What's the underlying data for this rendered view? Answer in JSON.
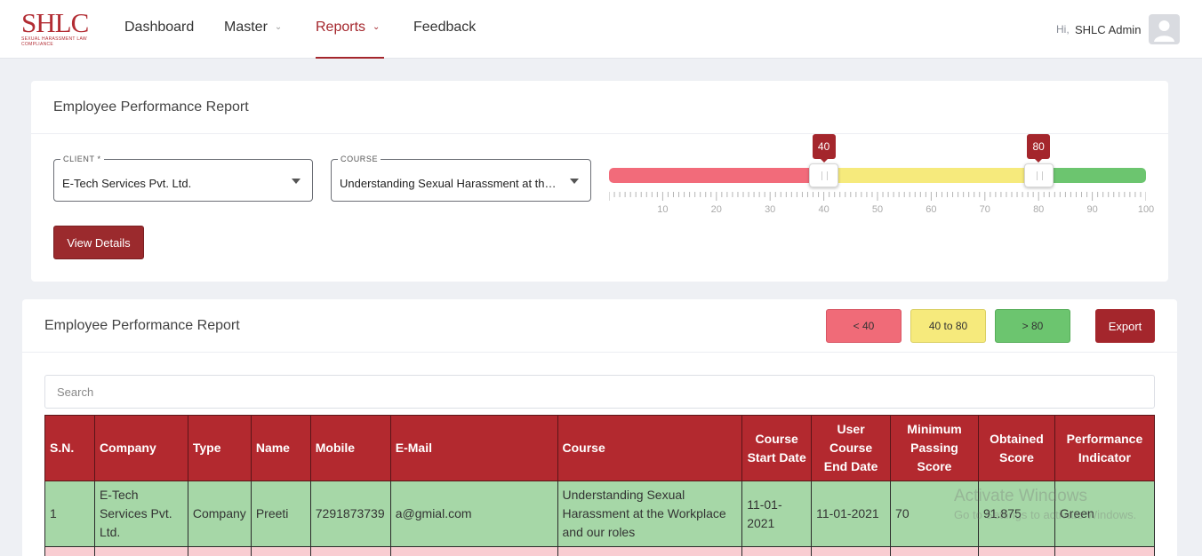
{
  "header": {
    "logo_main": "SHLC",
    "logo_sub": "Sexual Harassment Law Compliance",
    "nav": [
      {
        "label": "Dashboard"
      },
      {
        "label": "Master"
      },
      {
        "label": "Reports"
      },
      {
        "label": "Feedback"
      }
    ],
    "greeting": "Hi,",
    "user_name": "SHLC Admin"
  },
  "filters": {
    "title": "Employee Performance Report",
    "client_label": "CLIENT *",
    "client_value": "E-Tech Services Pvt. Ltd.",
    "course_label": "COURSE",
    "course_value": "Understanding Sexual Harassment at the Workplace and our roles",
    "view_button": "View Details",
    "range_low": "40",
    "range_high": "80",
    "range_min": 0,
    "range_max": 100,
    "scale_labels": [
      "10",
      "20",
      "30",
      "40",
      "50",
      "60",
      "70",
      "80",
      "90",
      "100"
    ]
  },
  "report": {
    "title": "Employee Performance Report",
    "buttons": {
      "low": "< 40",
      "mid": "40 to 80",
      "high": "> 80",
      "export": "Export"
    },
    "search_placeholder": "Search",
    "columns": [
      "S.N.",
      "Company",
      "Type",
      "Name",
      "Mobile",
      "E-Mail",
      "Course",
      "Course Start Date",
      "User Course End Date",
      "Minimum Passing Score",
      "Obtained Score",
      "Performance Indicator"
    ],
    "rows": [
      {
        "sn": "1",
        "company": "E-Tech Services Pvt. Ltd.",
        "type": "Company",
        "name": "Preeti",
        "mobile": "7291873739",
        "email": "a@gmial.com",
        "course": "Understanding Sexual Harassment at the Workplace and our roles",
        "start_date": "11-01-2021",
        "end_date": "11-01-2021",
        "min_score": "70",
        "obtained": "91.875",
        "indicator": "Green"
      }
    ]
  },
  "watermark": {
    "line1": "Activate Windows",
    "line2": "Go to Settings to activate Windows."
  },
  "colors": {
    "brand": "#a4262c",
    "low": "#f26b7a",
    "mid": "#f6ea7c",
    "high": "#6cc56f"
  }
}
